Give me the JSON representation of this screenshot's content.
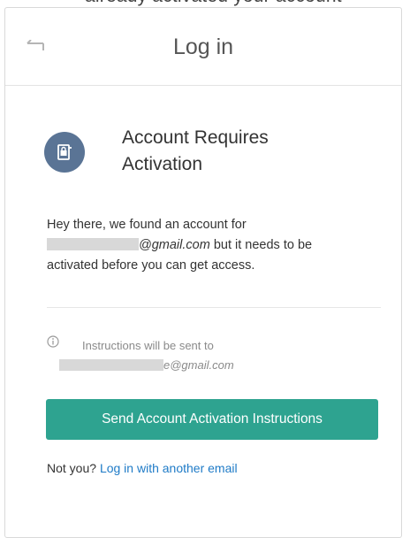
{
  "top_fragment": "already activated your account",
  "header": {
    "title": "Log in",
    "back_icon": "back-arrow-icon"
  },
  "info": {
    "icon": "lock-icon",
    "heading": "Account Requires Activation"
  },
  "message": {
    "prefix": "Hey there, we found an account for",
    "email_suffix": "@gmail.com",
    "rest": " but it needs to be activated before you can get access."
  },
  "notice": {
    "icon": "info-circle-icon",
    "text": "Instructions will be sent to",
    "email_suffix": "e@gmail.com"
  },
  "send_button": {
    "label": "Send Account Activation Instructions",
    "color": "#2ea390"
  },
  "alt": {
    "prefix": "Not you? ",
    "link": "Log in with another email",
    "link_color": "#1f7bc7"
  },
  "colors": {
    "icon_circle": "#5a7495",
    "redaction": "#d8d8d8"
  }
}
